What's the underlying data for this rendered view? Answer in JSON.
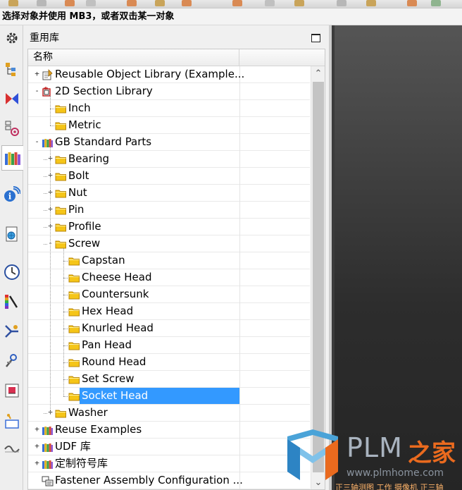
{
  "status": {
    "prompt": "选择对象并使用 MB3，或者双击某一对象"
  },
  "panel": {
    "title": "重用库",
    "column_header": "名称"
  },
  "tree": [
    {
      "label": "Reusable Object Library (Example...",
      "level": 0,
      "expander": "+",
      "icon": "reuse-object-library-icon",
      "selected": false
    },
    {
      "label": "2D Section Library",
      "level": 0,
      "expander": "-",
      "icon": "section-library-icon",
      "selected": false
    },
    {
      "label": "Inch",
      "level": 1,
      "expander": "",
      "icon": "folder-icon",
      "selected": false
    },
    {
      "label": "Metric",
      "level": 1,
      "expander": "",
      "icon": "folder-icon",
      "selected": false
    },
    {
      "label": "GB Standard Parts",
      "level": 0,
      "expander": "-",
      "icon": "books-library-icon",
      "selected": false
    },
    {
      "label": "Bearing",
      "level": 1,
      "expander": "+",
      "icon": "folder-icon",
      "selected": false
    },
    {
      "label": "Bolt",
      "level": 1,
      "expander": "+",
      "icon": "folder-icon",
      "selected": false
    },
    {
      "label": "Nut",
      "level": 1,
      "expander": "+",
      "icon": "folder-icon",
      "selected": false
    },
    {
      "label": "Pin",
      "level": 1,
      "expander": "+",
      "icon": "folder-icon",
      "selected": false
    },
    {
      "label": "Profile",
      "level": 1,
      "expander": "+",
      "icon": "folder-icon",
      "selected": false
    },
    {
      "label": "Screw",
      "level": 1,
      "expander": "-",
      "icon": "folder-icon",
      "selected": false
    },
    {
      "label": "Capstan",
      "level": 2,
      "expander": "",
      "icon": "folder-icon",
      "selected": false
    },
    {
      "label": "Cheese Head",
      "level": 2,
      "expander": "",
      "icon": "folder-icon",
      "selected": false
    },
    {
      "label": "Countersunk",
      "level": 2,
      "expander": "",
      "icon": "folder-icon",
      "selected": false
    },
    {
      "label": "Hex Head",
      "level": 2,
      "expander": "",
      "icon": "folder-icon",
      "selected": false
    },
    {
      "label": "Knurled Head",
      "level": 2,
      "expander": "",
      "icon": "folder-icon",
      "selected": false
    },
    {
      "label": "Pan Head",
      "level": 2,
      "expander": "",
      "icon": "folder-icon",
      "selected": false
    },
    {
      "label": "Round Head",
      "level": 2,
      "expander": "",
      "icon": "folder-icon",
      "selected": false
    },
    {
      "label": "Set Screw",
      "level": 2,
      "expander": "",
      "icon": "folder-icon",
      "selected": false
    },
    {
      "label": "Socket Head",
      "level": 2,
      "expander": "",
      "icon": "folder-icon",
      "selected": true
    },
    {
      "label": "Washer",
      "level": 1,
      "expander": "+",
      "icon": "folder-icon",
      "selected": false
    },
    {
      "label": "Reuse Examples",
      "level": 0,
      "expander": "+",
      "icon": "books-library-icon",
      "selected": false
    },
    {
      "label": "UDF 库",
      "level": 0,
      "expander": "+",
      "icon": "books-library-icon",
      "selected": false
    },
    {
      "label": "定制符号库",
      "level": 0,
      "expander": "+",
      "icon": "books-library-icon",
      "selected": false
    },
    {
      "label": "Fastener Assembly Configuration ...",
      "level": 0,
      "expander": "",
      "icon": "fastener-config-icon",
      "selected": false
    }
  ],
  "resource_tabs": [
    {
      "icon": "gear-icon",
      "active": false
    },
    {
      "icon": "assembly-navigator-icon",
      "active": false
    },
    {
      "icon": "constraint-navigator-icon",
      "active": false
    },
    {
      "icon": "part-navigator-icon",
      "active": false
    },
    {
      "icon": "reuse-library-icon",
      "active": true
    },
    {
      "icon": "info-feed-icon",
      "active": false
    },
    {
      "icon": "web-browser-icon",
      "active": false
    },
    {
      "icon": "history-clock-icon",
      "active": false
    },
    {
      "icon": "color-palette-icon",
      "active": false
    },
    {
      "icon": "process-studio-icon",
      "active": false
    },
    {
      "icon": "manufacturing-wizard-icon",
      "active": false
    },
    {
      "icon": "roles-icon",
      "active": false
    },
    {
      "icon": "system-materials-icon",
      "active": false
    },
    {
      "icon": "sketch-icon",
      "active": false
    }
  ],
  "watermark": {
    "brand": "PLM",
    "brand_cn": "之家",
    "url": "www.plmhome.com",
    "bottom_text": "正三轴测图 工作 摄像机 正三轴"
  },
  "colors": {
    "selection": "#3399ff",
    "folder": "#f5c518",
    "folder_edge": "#b8860b",
    "brand_orange": "#ea6a1e"
  }
}
